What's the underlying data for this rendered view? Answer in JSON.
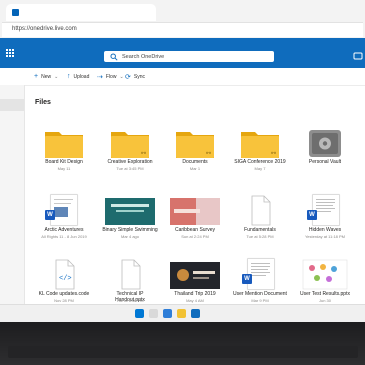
{
  "browser": {
    "tab_title": "",
    "url": "https://onedrive.live.com"
  },
  "header": {
    "search_placeholder": "Search OneDrive"
  },
  "commands": [
    {
      "label": "New",
      "icon": "plus-icon"
    },
    {
      "label": "Upload",
      "icon": "upload-icon"
    },
    {
      "label": "Flow",
      "icon": "flow-icon"
    },
    {
      "label": "Sync",
      "icon": "sync-icon"
    }
  ],
  "main": {
    "section_title": "Files",
    "rows": [
      [
        {
          "name": "Board Kit Design",
          "meta": "May 11",
          "kind": "folder"
        },
        {
          "name": "Creative Exploration",
          "meta": "Tue at 3:45 PM",
          "kind": "shared-folder"
        },
        {
          "name": "Documents",
          "meta": "Mar 1",
          "kind": "shared-folder"
        },
        {
          "name": "SIGA Conference 2019",
          "meta": "May 7",
          "kind": "shared-folder"
        },
        {
          "name": "Personal Vault",
          "meta": "",
          "kind": "vault"
        }
      ],
      [
        {
          "name": "Arctic Adventures",
          "meta": "All Rights 11 - 8 Jun 2019",
          "kind": "word"
        },
        {
          "name": "Binary Simple Swimming",
          "meta": "Mar 4 ago",
          "kind": "ppt-teal"
        },
        {
          "name": "Caribbean Survey",
          "meta": "Sun at 2:24 PM",
          "kind": "ppt-pink"
        },
        {
          "name": "Fundamentals",
          "meta": "Tue at 5:28 PM",
          "kind": "page"
        },
        {
          "name": "Hidden Waves",
          "meta": "Yesterday at 11:18 PM",
          "kind": "word-dense"
        }
      ],
      [
        {
          "name": "KL Code updates.code",
          "meta": "Nov 28 PM",
          "kind": "code"
        },
        {
          "name": "Technical IP Handout.pptx",
          "meta": "Tue at 6:38 PM",
          "kind": "page"
        },
        {
          "name": "Thailand Trip 2019",
          "meta": "May 4 AM",
          "kind": "ppt-dark"
        },
        {
          "name": "User Mention Document",
          "meta": "Mar 9 PM",
          "kind": "word-dense"
        },
        {
          "name": "User Test Results.pptx",
          "meta": "Jun 30",
          "kind": "ppt-colorful"
        }
      ]
    ]
  },
  "colors": {
    "brand": "#0f6cbd",
    "folder": "#f8c33b",
    "folder_dark": "#e5a60f",
    "word": "#185abd"
  }
}
